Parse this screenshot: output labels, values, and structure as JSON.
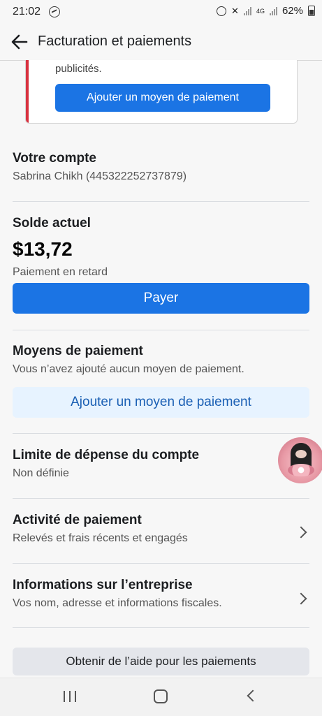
{
  "status_bar": {
    "time": "21:02",
    "battery": "62%",
    "network": "4G"
  },
  "app_bar": {
    "title": "Facturation et paiements"
  },
  "payment_card": {
    "text": "publicités.",
    "button_label": "Ajouter un moyen de paiement",
    "accent_color": "#d8313f"
  },
  "account": {
    "title": "Votre compte",
    "value": "Sabrina Chikh (445322252737879)"
  },
  "balance": {
    "title": "Solde actuel",
    "amount": "$13,72",
    "status": "Paiement en retard",
    "pay_label": "Payer"
  },
  "payment_methods": {
    "title": "Moyens de paiement",
    "description": "Vous n’avez ajouté aucun moyen de paiement.",
    "button_label": "Ajouter un moyen de paiement"
  },
  "spending_limit": {
    "title": "Limite de dépense du compte",
    "value": "Non définie"
  },
  "payment_activity": {
    "title": "Activité de paiement",
    "description": "Relevés et frais récents et engagés"
  },
  "business_info": {
    "title": "Informations sur l’entreprise",
    "description": "Vos nom, adresse et informations fiscales."
  },
  "help": {
    "button_label": "Obtenir de l’aide pour les paiements"
  },
  "colors": {
    "primary": "#1b74e4",
    "primary_light": "#e7f3ff",
    "background": "#f7f7f7"
  },
  "icons": [
    "messenger-icon",
    "alarm-icon",
    "mute-icon",
    "signal-icon",
    "battery-icon",
    "back-arrow-icon",
    "chevron-right-icon",
    "profile-avatar",
    "recent-apps-icon",
    "home-icon",
    "nav-back-icon"
  ]
}
